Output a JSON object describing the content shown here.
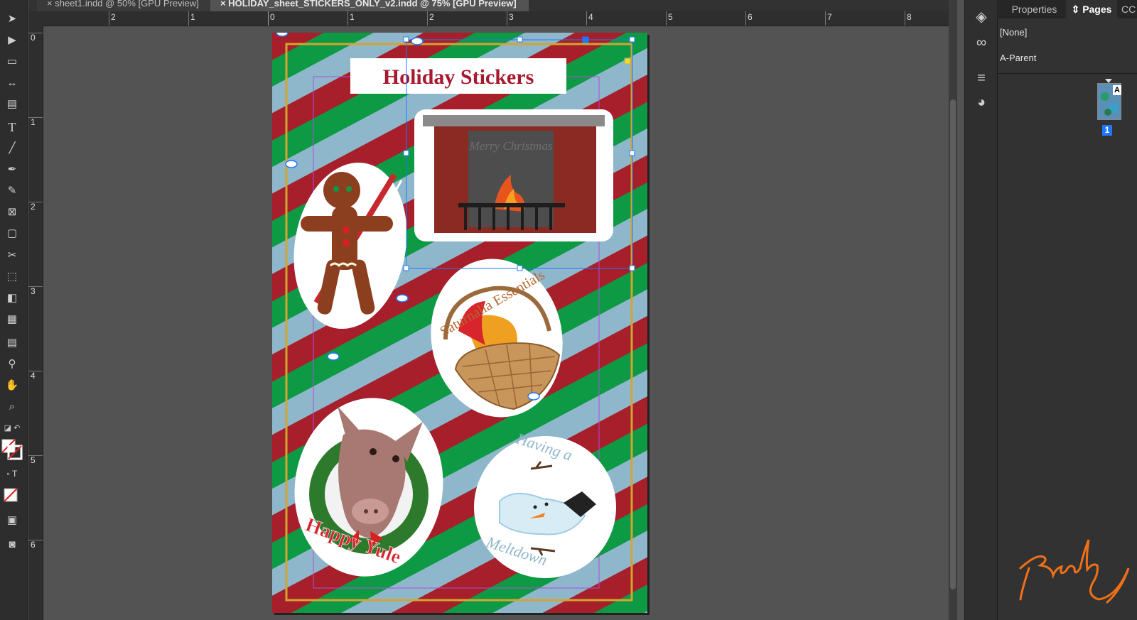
{
  "tabs": [
    {
      "label": "sheet1.indd @ 50% [GPU Preview]"
    },
    {
      "label": "HOLIDAY_sheet_STICKERS_ONLY_v2.indd @ 75% [GPU Preview]"
    }
  ],
  "ruler": {
    "horizontal": [
      "2",
      "1",
      "0",
      "1",
      "2",
      "3",
      "4",
      "5",
      "6",
      "7",
      "8"
    ],
    "vertical": [
      "0",
      "1",
      "2",
      "3",
      "4",
      "5",
      "6"
    ]
  },
  "tools": [
    "selection-tool",
    "direct-selection-tool",
    "page-tool",
    "gap-tool",
    "content-collector-tool",
    "type-tool",
    "line-tool",
    "pen-tool",
    "pencil-tool",
    "rectangle-frame-tool",
    "rectangle-tool",
    "scissors-tool",
    "free-transform-tool",
    "gradient-swatch-tool",
    "gradient-feather-tool",
    "note-tool",
    "eyedropper-tool",
    "hand-tool",
    "zoom-tool"
  ],
  "panel": {
    "tabs": [
      {
        "label": "Properties"
      },
      {
        "label": "Pages"
      },
      {
        "label": "CC"
      }
    ],
    "active_tab": "Pages",
    "masters": [
      "[None]",
      "A-Parent"
    ],
    "page_master_letter": "A",
    "page_number": "1"
  },
  "artwork": {
    "title": "Holiday Stickers",
    "fireplace_text": "Merry Christmas",
    "basket_text": "Saturnalia Essentials",
    "pig_text": "Happy Yule",
    "snowman_text_top": "Having a",
    "snowman_text_bottom": "Meltdown"
  },
  "colors": {
    "stripe_red": "#a61f2a",
    "stripe_green": "#0e9a44",
    "stripe_blue": "#8fb7cc",
    "margin_gold": "#d4a430",
    "title_red": "#a6192e",
    "selection_blue": "#1f78ff"
  }
}
